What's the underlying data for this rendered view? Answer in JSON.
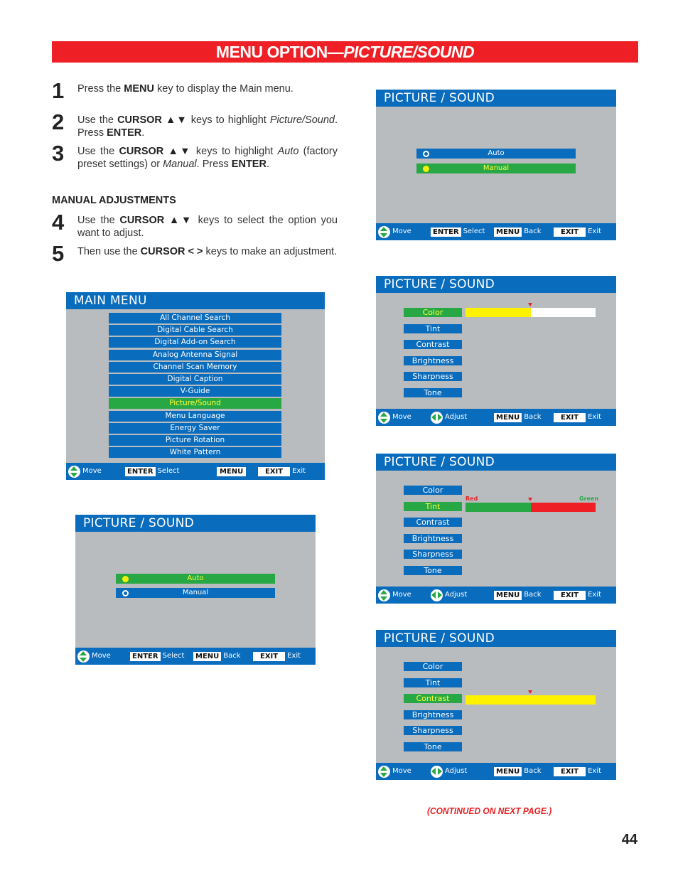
{
  "banner": {
    "title_plain": "MENU OPTION—",
    "title_italic": "PICTURE/SOUND"
  },
  "steps": [
    {
      "num": "1",
      "parts": [
        {
          "t": "Press the "
        },
        {
          "b": "MENU"
        },
        {
          "t": " key to display the Main menu."
        }
      ]
    },
    {
      "num": "2",
      "parts": [
        {
          "t": "Use the "
        },
        {
          "b": "CURSOR ▲▼"
        },
        {
          "t": " keys to highlight "
        },
        {
          "i": "Picture/Sound"
        },
        {
          "t": ". Press "
        },
        {
          "b": "ENTER"
        },
        {
          "t": "."
        }
      ]
    },
    {
      "num": "3",
      "parts": [
        {
          "t": "Use the "
        },
        {
          "b": "CURSOR ▲▼"
        },
        {
          "t": " keys to highlight "
        },
        {
          "i": "Auto"
        },
        {
          "t": " (factory preset settings) or "
        },
        {
          "i": "Manual"
        },
        {
          "t": ". Press "
        },
        {
          "b": "ENTER"
        },
        {
          "t": "."
        }
      ]
    },
    {
      "num": "4",
      "parts": [
        {
          "t": "Use the "
        },
        {
          "b": "CURSOR ▲▼"
        },
        {
          "t": " keys to select the option you want to adjust."
        }
      ]
    },
    {
      "num": "5",
      "parts": [
        {
          "t": "Then use the "
        },
        {
          "b": "CURSOR < >"
        },
        {
          "t": " keys to make an adjustment."
        }
      ]
    }
  ],
  "manual_heading": "MANUAL ADJUSTMENTS",
  "main_menu": {
    "title": "MAIN MENU",
    "items": [
      "All Channel Search",
      "Digital Cable Search",
      "Digital Add-on Search",
      "Analog Antenna Signal",
      "Channel Scan Memory",
      "Digital Caption",
      "V-Guide",
      "Picture/Sound",
      "Menu Language",
      "Energy Saver",
      "Picture Rotation",
      "White Pattern"
    ],
    "selected_index": 7,
    "footer": {
      "move": "Move",
      "enter_key": "ENTER",
      "select": "Select",
      "menu_key": "MENU",
      "exit_key": "EXIT",
      "exit": "Exit"
    }
  },
  "ps_auto": {
    "title": "PICTURE / SOUND",
    "options": [
      "Auto",
      "Manual"
    ],
    "selected_index": 0,
    "footer": {
      "move": "Move",
      "enter_key": "ENTER",
      "select": "Select",
      "menu_key": "MENU",
      "back": "Back",
      "exit_key": "EXIT",
      "exit": "Exit"
    }
  },
  "ps_manual": {
    "title": "PICTURE / SOUND",
    "options": [
      "Auto",
      "Manual"
    ],
    "selected_index": 1,
    "footer": {
      "move": "Move",
      "enter_key": "ENTER",
      "select": "Select",
      "menu_key": "MENU",
      "back": "Back",
      "exit_key": "EXIT",
      "exit": "Exit"
    }
  },
  "adjust_items": [
    "Color",
    "Tint",
    "Contrast",
    "Brightness",
    "Sharpness",
    "Tone"
  ],
  "adjust_footer": {
    "move": "Move",
    "adjust": "Adjust",
    "menu_key": "MENU",
    "back": "Back",
    "exit_key": "EXIT",
    "exit": "Exit"
  },
  "ps_color": {
    "title": "PICTURE / SOUND",
    "selected_index": 0,
    "level_percent": 50,
    "fill_color": "#fff200",
    "rest_color": "#ffffff"
  },
  "ps_tint": {
    "title": "PICTURE / SOUND",
    "selected_index": 1,
    "level_percent": 50,
    "left_label": "Red",
    "right_label": "Green",
    "left_color": "#27a844",
    "right_color": "#ee1f25"
  },
  "ps_contrast": {
    "title": "PICTURE / SOUND",
    "selected_index": 2,
    "level_percent": 50,
    "fill_color": "#fff200"
  },
  "colors": {
    "accent_red": "#ee1f25",
    "osd_blue": "#0a6cbd",
    "osd_green": "#27a844",
    "osd_gray": "#b9bcbf",
    "highlight_yellow": "#ffff3a"
  },
  "continued": "(CONTINUED ON NEXT PAGE.)",
  "page_number": "44"
}
